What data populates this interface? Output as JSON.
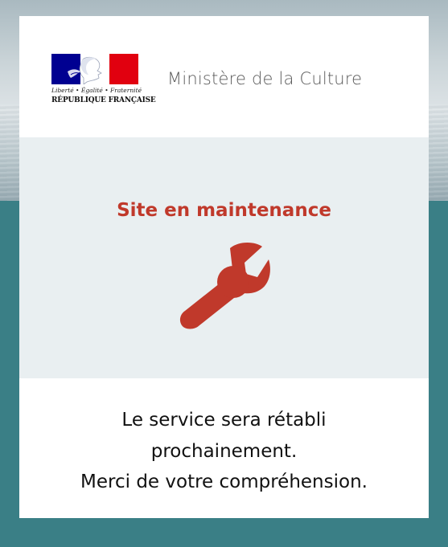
{
  "background": {
    "top_color": "#c9d3d7",
    "bottom_color": "#3a7f86"
  },
  "header": {
    "logo": {
      "motto": "Liberté • Égalité • Fraternité",
      "republic": "RÉPUBLIQUE FRANÇAISE",
      "flag_colors": [
        "#000091",
        "#ffffff",
        "#e1000f"
      ]
    },
    "ministry": "Ministère de la Culture"
  },
  "maintenance": {
    "title": "Site en maintenance",
    "icon": "wrench-icon",
    "accent_color": "#c0392b",
    "panel_color": "#e9eff1"
  },
  "message": {
    "line1": "Le service sera rétabli",
    "line2": "prochainement.",
    "line3": "Merci de votre compréhension."
  }
}
